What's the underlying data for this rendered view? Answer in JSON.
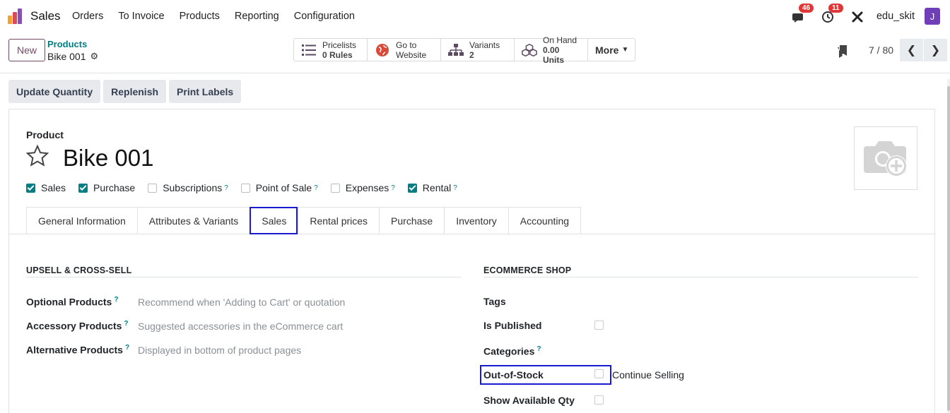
{
  "navbar": {
    "app_name": "Sales",
    "menu": [
      "Orders",
      "To Invoice",
      "Products",
      "Reporting",
      "Configuration"
    ],
    "messages_count": "46",
    "activities_count": "11",
    "username": "edu_skit",
    "avatar_letter": "J"
  },
  "control_panel": {
    "new_label": "New",
    "breadcrumb_parent": "Products",
    "breadcrumb_current": "Bike 001",
    "smart_buttons": [
      {
        "line1": "Pricelists",
        "line2": "0 Rules",
        "icon": "list-icon"
      },
      {
        "line1": "Go to",
        "line2": "Website",
        "icon": "globe-icon"
      },
      {
        "line1": "Variants",
        "line2": "2",
        "icon": "sitemap-icon"
      },
      {
        "line1": "On Hand",
        "line2": "0.00 Units",
        "icon": "cubes-icon"
      }
    ],
    "more_label": "More",
    "pager": "7 / 80"
  },
  "actions": [
    "Update Quantity",
    "Replenish",
    "Print Labels"
  ],
  "form": {
    "product_label": "Product",
    "product_name": "Bike 001",
    "checkboxes": [
      {
        "label": "Sales",
        "checked": true,
        "help": false
      },
      {
        "label": "Purchase",
        "checked": true,
        "help": false
      },
      {
        "label": "Subscriptions",
        "checked": false,
        "help": true
      },
      {
        "label": "Point of Sale",
        "checked": false,
        "help": true
      },
      {
        "label": "Expenses",
        "checked": false,
        "help": true
      },
      {
        "label": "Rental",
        "checked": true,
        "help": true
      }
    ],
    "tabs": [
      "General Information",
      "Attributes & Variants",
      "Sales",
      "Rental prices",
      "Purchase",
      "Inventory",
      "Accounting"
    ],
    "active_tab": "Sales",
    "upsell": {
      "title": "UPSELL & CROSS-SELL",
      "rows": [
        {
          "label": "Optional Products",
          "placeholder": "Recommend when 'Adding to Cart' or quotation"
        },
        {
          "label": "Accessory Products",
          "placeholder": "Suggested accessories in the eCommerce cart"
        },
        {
          "label": "Alternative Products",
          "placeholder": "Displayed in bottom of product pages"
        }
      ]
    },
    "ecommerce": {
      "title": "ECOMMERCE SHOP",
      "tags_label": "Tags",
      "published_label": "Is Published",
      "categories_label": "Categories",
      "out_of_stock_label": "Out-of-Stock",
      "continue_selling_label": "Continue Selling",
      "show_qty_label": "Show Available Qty"
    }
  },
  "colors": {
    "brand": "#714b67",
    "accent": "#017e84",
    "highlight": "#1a1ad1"
  }
}
